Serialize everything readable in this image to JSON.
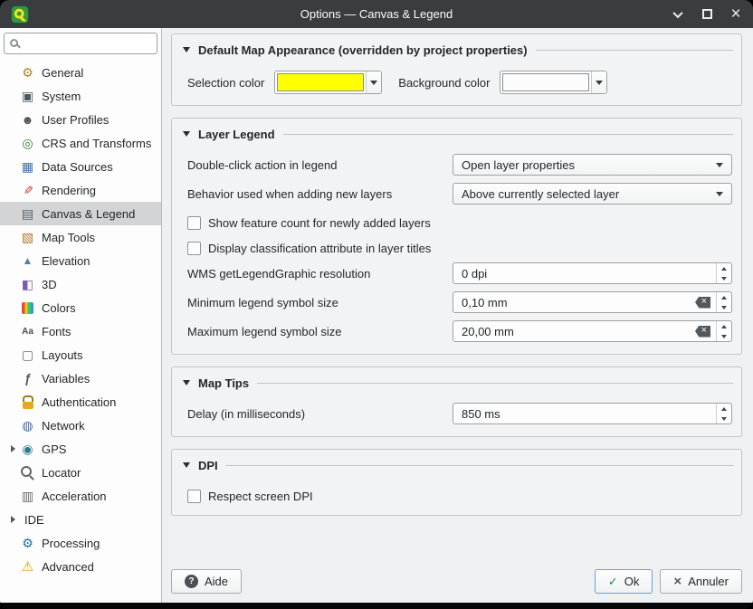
{
  "window": {
    "title": "Options — Canvas & Legend"
  },
  "sidebar": {
    "search": {
      "placeholder": ""
    },
    "items": [
      {
        "id": "general",
        "label": "General",
        "icon": "tools-gear-icon"
      },
      {
        "id": "system",
        "label": "System",
        "icon": "system-monitor-icon"
      },
      {
        "id": "user-profiles",
        "label": "User Profiles",
        "icon": "user-icon"
      },
      {
        "id": "crs-and-transforms",
        "label": "CRS and Transforms",
        "icon": "globe-crs-icon"
      },
      {
        "id": "data-sources",
        "label": "Data Sources",
        "icon": "table-data-icon"
      },
      {
        "id": "rendering",
        "label": "Rendering",
        "icon": "paintbrush-icon"
      },
      {
        "id": "canvas-legend",
        "label": "Canvas & Legend",
        "icon": "layer-list-icon",
        "selected": true
      },
      {
        "id": "map-tools",
        "label": "Map Tools",
        "icon": "map-tools-icon"
      },
      {
        "id": "elevation",
        "label": "Elevation",
        "icon": "mountain-icon"
      },
      {
        "id": "3d",
        "label": "3D",
        "icon": "cube-3d-icon"
      },
      {
        "id": "colors",
        "label": "Colors",
        "icon": "color-palette-icon"
      },
      {
        "id": "fonts",
        "label": "Fonts",
        "icon": "fonts-aa-icon"
      },
      {
        "id": "layouts",
        "label": "Layouts",
        "icon": "page-layout-icon"
      },
      {
        "id": "variables",
        "label": "Variables",
        "icon": "variable-fx-icon"
      },
      {
        "id": "authentication",
        "label": "Authentication",
        "icon": "lock-icon"
      },
      {
        "id": "network",
        "label": "Network",
        "icon": "network-globe-icon"
      },
      {
        "id": "gps",
        "label": "GPS",
        "icon": "gps-target-icon",
        "expandable": true
      },
      {
        "id": "locator",
        "label": "Locator",
        "icon": "magnifier-icon"
      },
      {
        "id": "acceleration",
        "label": "Acceleration",
        "icon": "chip-icon"
      },
      {
        "id": "ide",
        "label": "IDE",
        "expandable": true
      },
      {
        "id": "processing",
        "label": "Processing",
        "icon": "processing-gear-icon"
      },
      {
        "id": "advanced",
        "label": "Advanced",
        "icon": "warning-triangle-icon"
      }
    ]
  },
  "appearance": {
    "title": "Default Map Appearance (overridden by project properties)",
    "selection_color_label": "Selection color",
    "selection_color": "#ffff00",
    "background_color_label": "Background color",
    "background_color": "#fdfcfc"
  },
  "layer_legend": {
    "title": "Layer Legend",
    "double_click_label": "Double-click action in legend",
    "double_click_value": "Open layer properties",
    "new_layers_label": "Behavior used when adding new layers",
    "new_layers_value": "Above currently selected layer",
    "feature_count_label": "Show feature count for newly added layers",
    "feature_count_checked": false,
    "classification_label": "Display classification attribute in layer titles",
    "classification_checked": false,
    "wms_label": "WMS getLegendGraphic resolution",
    "wms_value": "0 dpi",
    "min_symbol_label": "Minimum legend symbol size",
    "min_symbol_value": "0,10 mm",
    "max_symbol_label": "Maximum legend symbol size",
    "max_symbol_value": "20,00 mm"
  },
  "map_tips": {
    "title": "Map Tips",
    "delay_label": "Delay (in milliseconds)",
    "delay_value": "850 ms"
  },
  "dpi": {
    "title": "DPI",
    "respect_label": "Respect screen DPI",
    "respect_checked": false
  },
  "footer": {
    "help_label": "Aide",
    "ok_label": "Ok",
    "cancel_label": "Annuler"
  }
}
